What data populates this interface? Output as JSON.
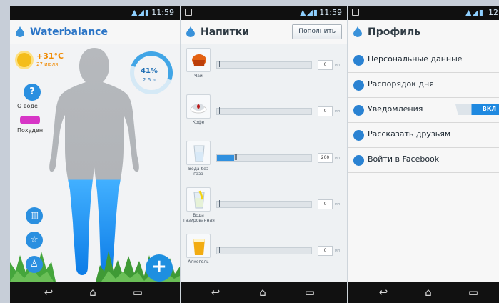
{
  "status": {
    "time_1": "11:59",
    "time_2": "11:59",
    "time_3": "12"
  },
  "panel1": {
    "title": "Waterbalance",
    "weather": {
      "temp": "+31°C",
      "date": "27 июля"
    },
    "progress": {
      "percent_label": "41%",
      "volume_label": "2.6 л",
      "value": 0.41
    },
    "side_buttons": [
      {
        "label": "О воде",
        "icon": "help-icon"
      },
      {
        "label": "Похуден.",
        "icon": "candy-icon"
      }
    ],
    "bottom_icons": [
      "stats-icon",
      "star-icon",
      "profile-icon"
    ],
    "add_button": "+"
  },
  "panel2": {
    "title": "Напитки",
    "action": "Пополнить",
    "drinks": [
      {
        "name": "Чай",
        "value": "0",
        "unit": "мл",
        "fill": 0.0
      },
      {
        "name": "Кофе",
        "value": "0",
        "unit": "мл",
        "fill": 0.0
      },
      {
        "name": "Вода без газа",
        "value": "200",
        "unit": "мл",
        "fill": 0.18
      },
      {
        "name": "Вода газированная",
        "value": "0",
        "unit": "мл",
        "fill": 0.0
      },
      {
        "name": "Алкоголь",
        "value": "0",
        "unit": "мл",
        "fill": 0.0
      }
    ]
  },
  "panel3": {
    "title": "Профиль",
    "items": [
      {
        "label": "Персональные данные",
        "icon": "user-icon"
      },
      {
        "label": "Распорядок дня",
        "icon": "clock-icon"
      },
      {
        "label": "Уведомления",
        "icon": "bell-icon",
        "toggle": "ВКЛ"
      },
      {
        "label": "Рассказать друзьям",
        "icon": "chat-icon"
      },
      {
        "label": "Войти в Facebook",
        "icon": "facebook-icon"
      }
    ]
  },
  "colors": {
    "accent": "#2a82d2",
    "warm": "#f08a00",
    "pink": "#d735c6",
    "green": "#45a63c"
  }
}
